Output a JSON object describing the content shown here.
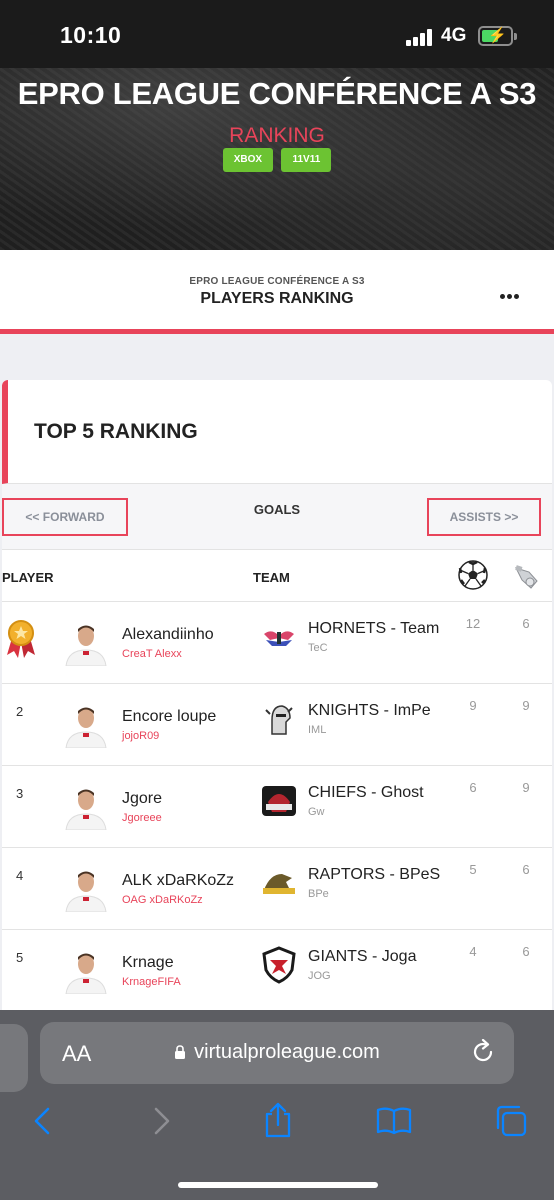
{
  "status_bar": {
    "time": "10:10",
    "network": "4G"
  },
  "hero": {
    "title": "EPRO LEAGUE CONFÉRENCE A S3",
    "subtitle": "RANKING",
    "tags": [
      "XBOX",
      "11V11"
    ]
  },
  "page_header": {
    "league": "EPRO LEAGUE CONFÉRENCE A S3",
    "title": "PLAYERS RANKING"
  },
  "card": {
    "title": "TOP 5 RANKING",
    "nav": {
      "prev": "FORWARD",
      "current": "GOALS",
      "next": "ASSISTS"
    },
    "columns": {
      "player": "PLAYER",
      "team": "TEAM"
    },
    "rows": [
      {
        "rank": "1",
        "player": "Alexandiinho",
        "handle": "CreaT Alexx",
        "team": "HORNETS - Team",
        "team_abbr": "TeC",
        "goals": "12",
        "assists": "6"
      },
      {
        "rank": "2",
        "player": "Encore loupe",
        "handle": "jojoR09",
        "team": "KNIGHTS - ImPe",
        "team_abbr": "IML",
        "goals": "9",
        "assists": "9"
      },
      {
        "rank": "3",
        "player": "Jgore",
        "handle": "Jgoreee",
        "team": "CHIEFS - Ghost",
        "team_abbr": "Gw",
        "goals": "6",
        "assists": "9"
      },
      {
        "rank": "4",
        "player": "ALK xDaRKoZz",
        "handle": "OAG xDaRKoZz",
        "team": "RAPTORS - BPeS",
        "team_abbr": "BPe",
        "goals": "5",
        "assists": "6"
      },
      {
        "rank": "5",
        "player": "Krnage",
        "handle": "KrnageFIFA",
        "team": "GIANTS - Joga",
        "team_abbr": "JOG",
        "goals": "4",
        "assists": "6"
      }
    ]
  },
  "browser": {
    "text_size_label": "AA",
    "url": "virtualproleague.com"
  },
  "colors": {
    "accent": "#e8445a",
    "tag_green": "#6cc332",
    "ios_blue": "#0a84ff"
  }
}
